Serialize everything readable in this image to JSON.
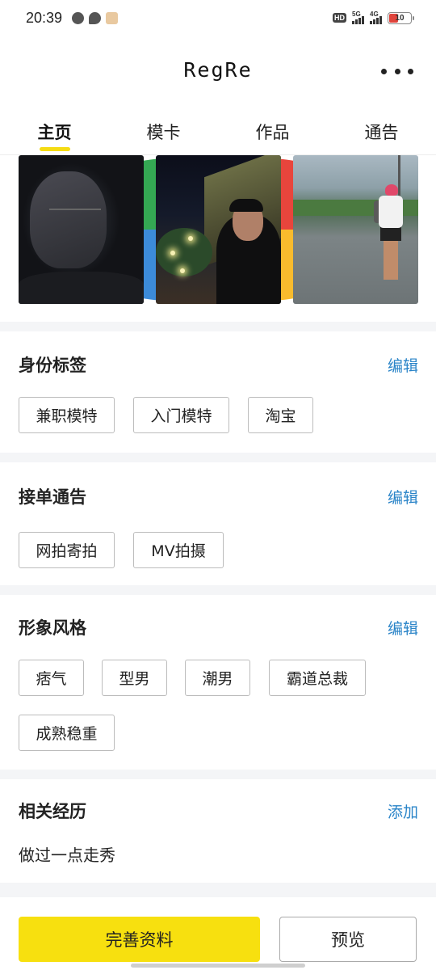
{
  "status_bar": {
    "time": "20:39",
    "hd_label": "HD",
    "net1_label": "5G",
    "net2_label": "4G",
    "battery": "10"
  },
  "header": {
    "title": "RegRe"
  },
  "tabs": [
    {
      "label": "主页",
      "active": true
    },
    {
      "label": "模卡",
      "active": false
    },
    {
      "label": "作品",
      "active": false
    },
    {
      "label": "通告",
      "active": false
    }
  ],
  "identity_tags": {
    "title": "身份标签",
    "action": "编辑",
    "tags": [
      "兼职模特",
      "入门模特",
      "淘宝"
    ]
  },
  "order_notices": {
    "title": "接单通告",
    "action": "编辑",
    "tags": [
      "网拍寄拍",
      "MV拍摄"
    ]
  },
  "image_style": {
    "title": "形象风格",
    "action": "编辑",
    "tags": [
      "痞气",
      "型男",
      "潮男",
      "霸道总裁",
      "成熟稳重"
    ]
  },
  "experience": {
    "title": "相关经历",
    "action": "添加",
    "text": "做过一点走秀"
  },
  "bottom": {
    "primary_label": "完善资料",
    "secondary_label": "预览"
  },
  "colors": {
    "accent_yellow": "#f7e00f",
    "link_blue": "#2a84c8"
  }
}
